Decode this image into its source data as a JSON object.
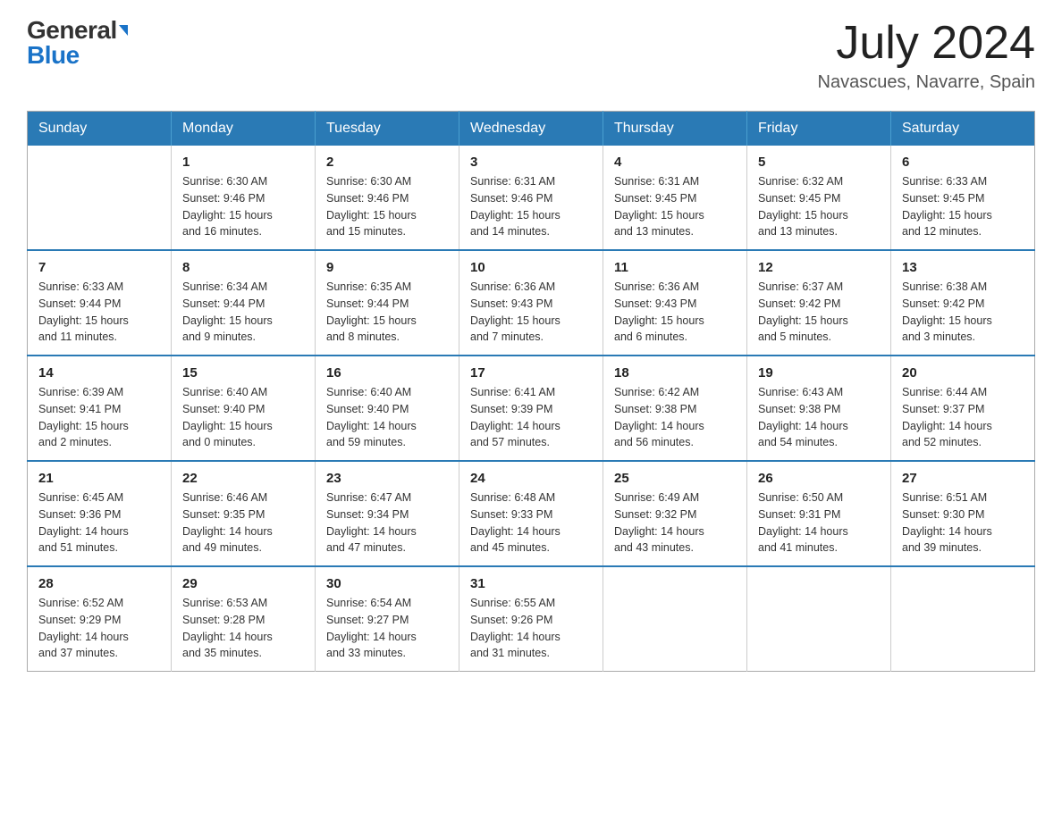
{
  "header": {
    "logo_general": "General",
    "logo_blue": "Blue",
    "month_year": "July 2024",
    "location": "Navascues, Navarre, Spain"
  },
  "days_of_week": [
    "Sunday",
    "Monday",
    "Tuesday",
    "Wednesday",
    "Thursday",
    "Friday",
    "Saturday"
  ],
  "weeks": [
    [
      {
        "day": "",
        "info": ""
      },
      {
        "day": "1",
        "info": "Sunrise: 6:30 AM\nSunset: 9:46 PM\nDaylight: 15 hours\nand 16 minutes."
      },
      {
        "day": "2",
        "info": "Sunrise: 6:30 AM\nSunset: 9:46 PM\nDaylight: 15 hours\nand 15 minutes."
      },
      {
        "day": "3",
        "info": "Sunrise: 6:31 AM\nSunset: 9:46 PM\nDaylight: 15 hours\nand 14 minutes."
      },
      {
        "day": "4",
        "info": "Sunrise: 6:31 AM\nSunset: 9:45 PM\nDaylight: 15 hours\nand 13 minutes."
      },
      {
        "day": "5",
        "info": "Sunrise: 6:32 AM\nSunset: 9:45 PM\nDaylight: 15 hours\nand 13 minutes."
      },
      {
        "day": "6",
        "info": "Sunrise: 6:33 AM\nSunset: 9:45 PM\nDaylight: 15 hours\nand 12 minutes."
      }
    ],
    [
      {
        "day": "7",
        "info": "Sunrise: 6:33 AM\nSunset: 9:44 PM\nDaylight: 15 hours\nand 11 minutes."
      },
      {
        "day": "8",
        "info": "Sunrise: 6:34 AM\nSunset: 9:44 PM\nDaylight: 15 hours\nand 9 minutes."
      },
      {
        "day": "9",
        "info": "Sunrise: 6:35 AM\nSunset: 9:44 PM\nDaylight: 15 hours\nand 8 minutes."
      },
      {
        "day": "10",
        "info": "Sunrise: 6:36 AM\nSunset: 9:43 PM\nDaylight: 15 hours\nand 7 minutes."
      },
      {
        "day": "11",
        "info": "Sunrise: 6:36 AM\nSunset: 9:43 PM\nDaylight: 15 hours\nand 6 minutes."
      },
      {
        "day": "12",
        "info": "Sunrise: 6:37 AM\nSunset: 9:42 PM\nDaylight: 15 hours\nand 5 minutes."
      },
      {
        "day": "13",
        "info": "Sunrise: 6:38 AM\nSunset: 9:42 PM\nDaylight: 15 hours\nand 3 minutes."
      }
    ],
    [
      {
        "day": "14",
        "info": "Sunrise: 6:39 AM\nSunset: 9:41 PM\nDaylight: 15 hours\nand 2 minutes."
      },
      {
        "day": "15",
        "info": "Sunrise: 6:40 AM\nSunset: 9:40 PM\nDaylight: 15 hours\nand 0 minutes."
      },
      {
        "day": "16",
        "info": "Sunrise: 6:40 AM\nSunset: 9:40 PM\nDaylight: 14 hours\nand 59 minutes."
      },
      {
        "day": "17",
        "info": "Sunrise: 6:41 AM\nSunset: 9:39 PM\nDaylight: 14 hours\nand 57 minutes."
      },
      {
        "day": "18",
        "info": "Sunrise: 6:42 AM\nSunset: 9:38 PM\nDaylight: 14 hours\nand 56 minutes."
      },
      {
        "day": "19",
        "info": "Sunrise: 6:43 AM\nSunset: 9:38 PM\nDaylight: 14 hours\nand 54 minutes."
      },
      {
        "day": "20",
        "info": "Sunrise: 6:44 AM\nSunset: 9:37 PM\nDaylight: 14 hours\nand 52 minutes."
      }
    ],
    [
      {
        "day": "21",
        "info": "Sunrise: 6:45 AM\nSunset: 9:36 PM\nDaylight: 14 hours\nand 51 minutes."
      },
      {
        "day": "22",
        "info": "Sunrise: 6:46 AM\nSunset: 9:35 PM\nDaylight: 14 hours\nand 49 minutes."
      },
      {
        "day": "23",
        "info": "Sunrise: 6:47 AM\nSunset: 9:34 PM\nDaylight: 14 hours\nand 47 minutes."
      },
      {
        "day": "24",
        "info": "Sunrise: 6:48 AM\nSunset: 9:33 PM\nDaylight: 14 hours\nand 45 minutes."
      },
      {
        "day": "25",
        "info": "Sunrise: 6:49 AM\nSunset: 9:32 PM\nDaylight: 14 hours\nand 43 minutes."
      },
      {
        "day": "26",
        "info": "Sunrise: 6:50 AM\nSunset: 9:31 PM\nDaylight: 14 hours\nand 41 minutes."
      },
      {
        "day": "27",
        "info": "Sunrise: 6:51 AM\nSunset: 9:30 PM\nDaylight: 14 hours\nand 39 minutes."
      }
    ],
    [
      {
        "day": "28",
        "info": "Sunrise: 6:52 AM\nSunset: 9:29 PM\nDaylight: 14 hours\nand 37 minutes."
      },
      {
        "day": "29",
        "info": "Sunrise: 6:53 AM\nSunset: 9:28 PM\nDaylight: 14 hours\nand 35 minutes."
      },
      {
        "day": "30",
        "info": "Sunrise: 6:54 AM\nSunset: 9:27 PM\nDaylight: 14 hours\nand 33 minutes."
      },
      {
        "day": "31",
        "info": "Sunrise: 6:55 AM\nSunset: 9:26 PM\nDaylight: 14 hours\nand 31 minutes."
      },
      {
        "day": "",
        "info": ""
      },
      {
        "day": "",
        "info": ""
      },
      {
        "day": "",
        "info": ""
      }
    ]
  ]
}
